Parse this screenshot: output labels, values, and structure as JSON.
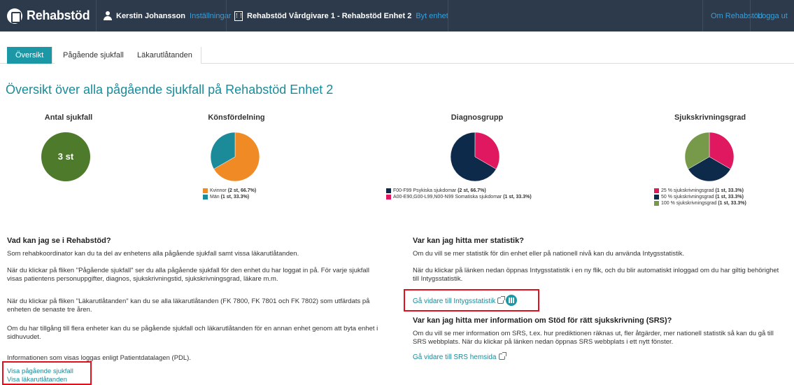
{
  "header": {
    "brand": "Rehabstöd",
    "user_name": "Kerstin Johansson",
    "settings_link": "Inställningar",
    "unit_name": "Rehabstöd Vårdgivare 1 - Rehabstöd Enhet 2",
    "change_unit_link": "Byt enhet",
    "about_link": "Om Rehabstöd",
    "logout_link": "Logga ut"
  },
  "tabs": [
    "Översikt",
    "Pågående sjukfall",
    "Läkarutlåtanden"
  ],
  "page_title": "Översikt över alla pågående sjukfall på Rehabstöd Enhet 2",
  "stats": {
    "count": {
      "title": "Antal sjukfall",
      "value": "3 st",
      "color": "#4e7a2c"
    },
    "gender": {
      "title": "Könsfördelning",
      "items": [
        {
          "label": "Kvinnor",
          "detail": "(2 st, 66.7%)",
          "share": 66.7,
          "color": "#f08a24"
        },
        {
          "label": "Män",
          "detail": "(1 st, 33.3%)",
          "share": 33.3,
          "color": "#1b8a99"
        }
      ]
    },
    "diagnosis": {
      "title": "Diagnosgrupp",
      "items": [
        {
          "label": "F00-F99 Psykiska sjukdomar",
          "detail": "(2 st, 66.7%)",
          "share": 66.7,
          "color": "#0e2a4a"
        },
        {
          "label": "A00-E90,G00-L99,N00-N99 Somatiska sjukdomar",
          "detail": "(1 st, 33.3%)",
          "share": 33.3,
          "color": "#e0185f"
        }
      ]
    },
    "degree": {
      "title": "Sjukskrivningsgrad",
      "items": [
        {
          "label": "25 % sjukskrivningsgrad",
          "detail": "(1 st, 33.3%)",
          "share": 33.3,
          "color": "#e0185f"
        },
        {
          "label": "50 % sjukskrivningsgrad",
          "detail": "(1 st, 33.3%)",
          "share": 33.3,
          "color": "#0e2a4a"
        },
        {
          "label": "100 % sjukskrivningsgrad",
          "detail": "(1 st, 33.3%)",
          "share": 33.3,
          "color": "#76994a"
        }
      ]
    }
  },
  "left_info": {
    "heading": "Vad kan jag se i Rehabstöd?",
    "p1": "Som rehabkoordinator kan du ta del av enhetens alla pågående sjukfall samt vissa läkarutlåtanden.",
    "p2a": "När du klickar på fliken \"Pågående sjukfall\" ser du alla pågående sjukfall för den enhet du har loggat in på. För varje sjukfall",
    "p2b": "visas patientens personuppgifter, diagnos, sjukskrivningstid, sjukskrivningsgrad, läkare m.m.",
    "p3a": "När du klickar på fliken \"Läkarutlåtanden\" kan du se alla läkarutlåtanden (FK 7800, FK 7801 och FK 7802) som utfärdats på",
    "p3b": "enheten de senaste tre åren.",
    "p4a": "Om du har tillgång till flera enheter kan du se pågående sjukfall och läkarutlåtanden för en annan enhet genom att byta enhet i",
    "p4b": "sidhuvudet.",
    "p5": "Informationen som visas loggas enligt Patientdatalagen (PDL).",
    "link1": "Visa pågående sjukfall",
    "link2": "Visa läkarutlåtanden"
  },
  "right_info": {
    "heading1": "Var kan jag hitta mer statistik?",
    "p1": "Om du vill se mer statistik för din enhet eller på nationell nivå kan du använda Intygsstatistik.",
    "p2a": "När du klickar på länken nedan öppnas Intygsstatistik i en ny flik, och du blir automatiskt inloggad om du har giltig behörighet",
    "p2b": "till Intygsstatistik.",
    "link1": "Gå vidare till Intygsstatistik",
    "heading2": "Var kan jag hitta mer information om Stöd för rätt sjukskrivning (SRS)?",
    "p3a": "Om du vill se mer information om SRS, t.ex. hur prediktionen räknas ut, fler åtgärder, mer nationell statistik så kan du gå till",
    "p3b": "SRS webbplats. När du klickar på länken nedan öppnas SRS webbplats i ett nytt fönster.",
    "link2": "Gå vidare till SRS hemsida"
  }
}
